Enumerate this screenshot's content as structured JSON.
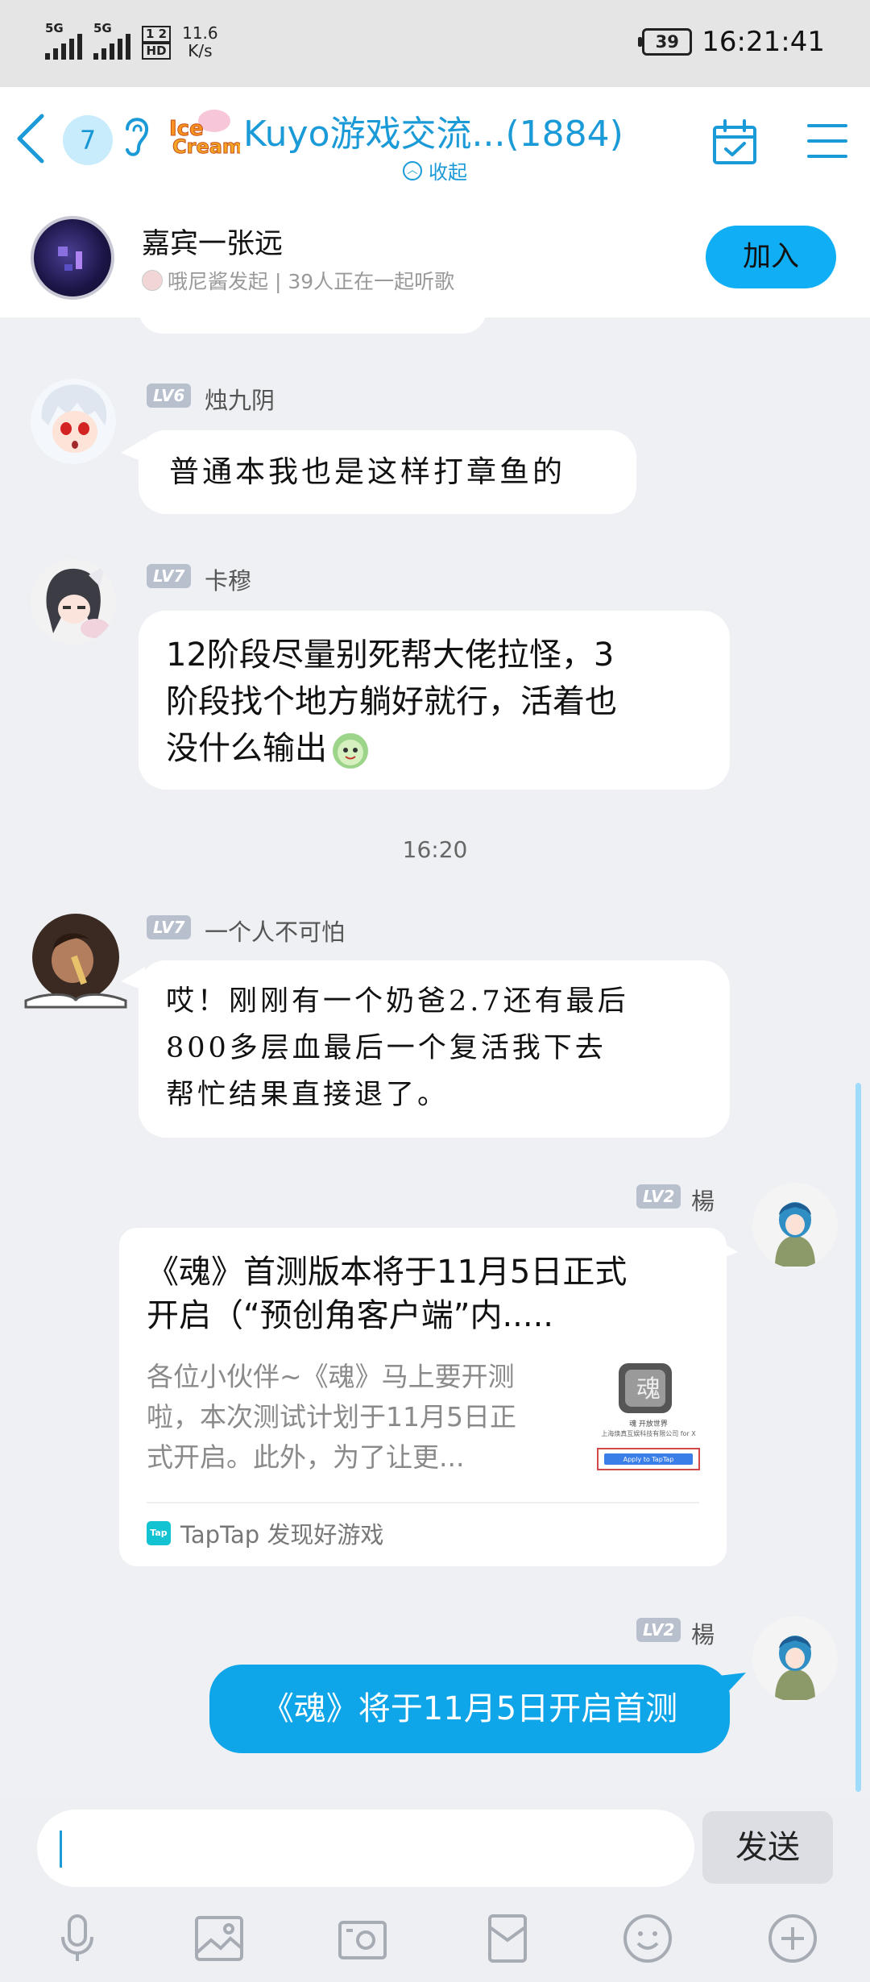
{
  "status_bar": {
    "sim1": "5G",
    "sim2": "5G",
    "hd_top": "1 2",
    "hd_bottom": "HD",
    "speed_value": "11.6",
    "speed_unit": "K/s",
    "battery": "39",
    "time": "16:21:41"
  },
  "header": {
    "unread_count": "7",
    "title": "Kuyo游戏交流...(1884)",
    "collapse_label": "收起",
    "logo_text": "Ice Cream"
  },
  "listen_together": {
    "title": "嘉宾一张远",
    "subtitle": "哦尼酱发起 | 39人正在一起听歌",
    "join_label": "加入"
  },
  "messages": [
    {
      "level": "LV6",
      "nickname": "烛九阴",
      "text": "普通本我也是这样打章鱼的"
    },
    {
      "level": "LV7",
      "nickname": "卡穆",
      "lines": [
        "12阶段尽量别死帮大佬拉怪，3",
        "阶段找个地方躺好就行，活着也",
        "没什么输出"
      ]
    },
    {
      "time": "16:20"
    },
    {
      "level": "LV7",
      "nickname": "一个人不可怕",
      "lines": [
        "哎！刚刚有一个奶爸2.7还有最后",
        "800多层血最后一个复活我下去",
        "帮忙结果直接退了。"
      ]
    },
    {
      "level": "LV2",
      "nickname": "楊",
      "card": {
        "title_lines": [
          "《魂》首测版本将于11月5日正式",
          "开启（“预创角客户端”内....."
        ],
        "desc_lines": [
          "各位小伙伴~《魂》马上要开测",
          "啦，本次测试计划于11月5日正",
          "式开启。此外，为了让更..."
        ],
        "thumb_caption": "魂 开放世界",
        "thumb_company": "上海焕真互娱科技有限公司 for X",
        "thumb_button": "Apply to TapTap",
        "source_icon": "Tap",
        "source": "TapTap 发现好游戏"
      }
    },
    {
      "level": "LV2",
      "nickname": "楊",
      "text": "《魂》将于11月5日开启首测"
    }
  ],
  "input_bar": {
    "placeholder": "",
    "send_label": "发送",
    "tools": [
      "microphone-icon",
      "image-icon",
      "camera-icon",
      "red-packet-icon",
      "emoji-icon",
      "plus-icon"
    ]
  },
  "colors": {
    "accent": "#1b9ad8",
    "join_button": "#10aef4",
    "my_bubble": "#0fa5e9",
    "level_badge": "#b8c0cd"
  }
}
